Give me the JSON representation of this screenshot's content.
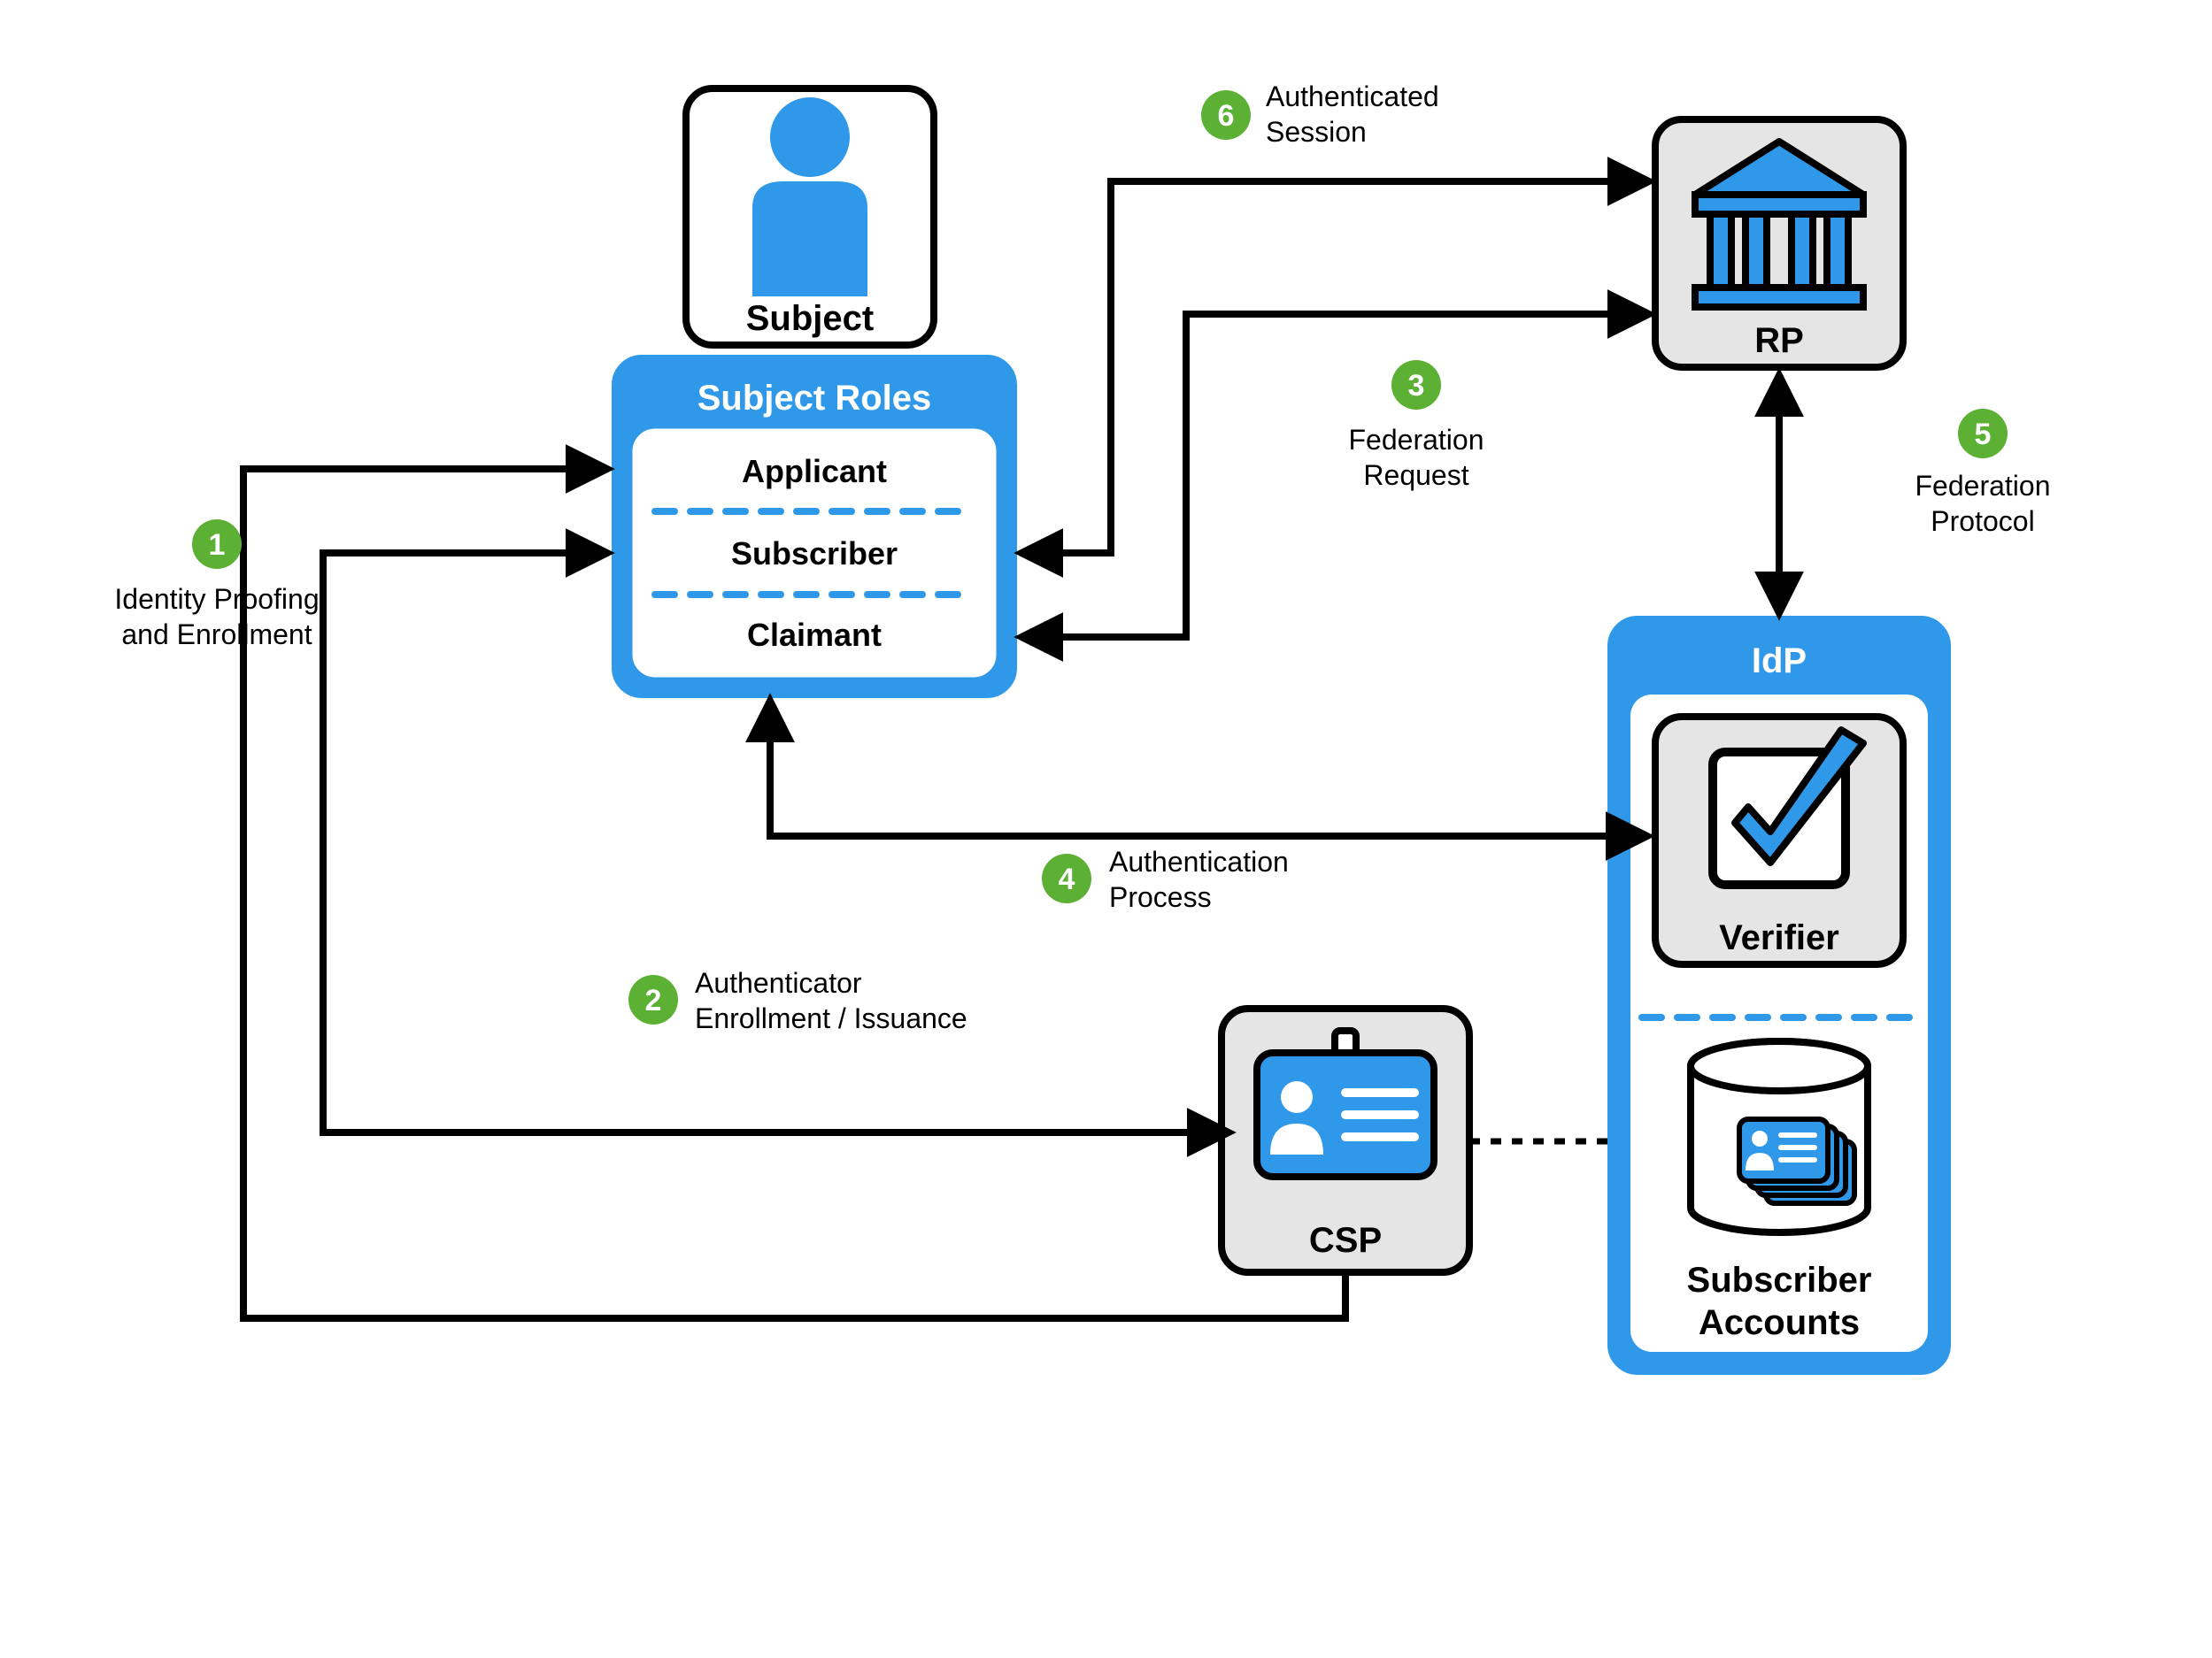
{
  "colors": {
    "blue": "#2f98e8",
    "green": "#5cb033",
    "grey": "#e5e5e5",
    "black": "#000000",
    "white": "#ffffff"
  },
  "nodes": {
    "subject": "Subject",
    "subject_roles_title": "Subject Roles",
    "roles": [
      "Applicant",
      "Subscriber",
      "Claimant"
    ],
    "rp": "RP",
    "idp_title": "IdP",
    "verifier": "Verifier",
    "subscriber_accounts_line1": "Subscriber",
    "subscriber_accounts_line2": "Accounts",
    "csp": "CSP"
  },
  "steps": {
    "s1": {
      "num": "1",
      "line1": "Identity Proofing",
      "line2": "and Enrollment"
    },
    "s2": {
      "num": "2",
      "line1": "Authenticator",
      "line2": "Enrollment / Issuance"
    },
    "s3": {
      "num": "3",
      "line1": "Federation",
      "line2": "Request"
    },
    "s4": {
      "num": "4",
      "line1": "Authentication",
      "line2": "Process"
    },
    "s5": {
      "num": "5",
      "line1": "Federation",
      "line2": "Protocol"
    },
    "s6": {
      "num": "6",
      "line1": "Authenticated",
      "line2": "Session"
    }
  }
}
